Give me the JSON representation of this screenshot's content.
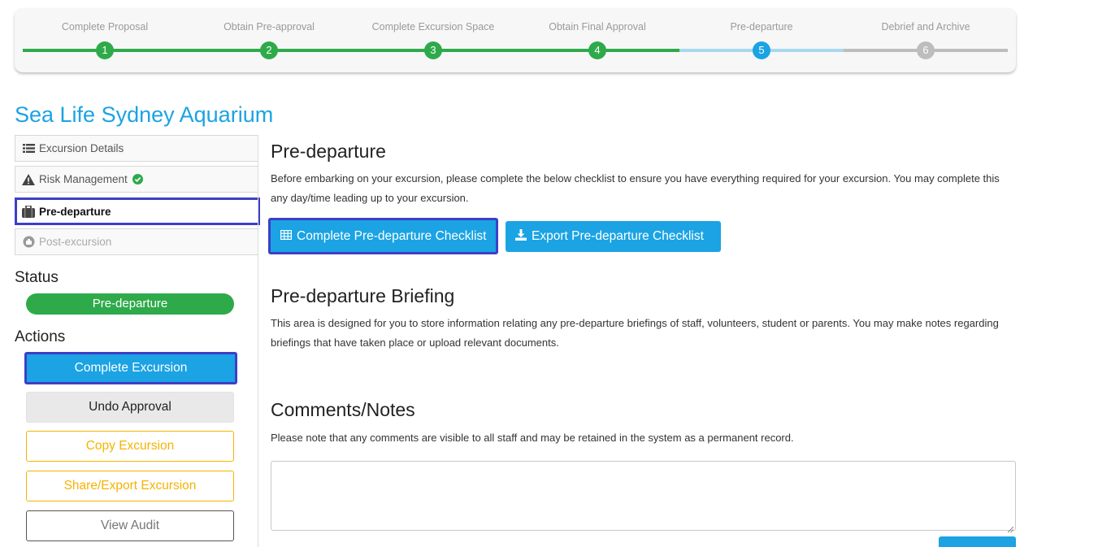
{
  "stepper": {
    "steps": [
      {
        "label": "Complete Proposal",
        "number": "1",
        "state": "done"
      },
      {
        "label": "Obtain Pre-approval",
        "number": "2",
        "state": "done"
      },
      {
        "label": "Complete Excursion Space",
        "number": "3",
        "state": "done"
      },
      {
        "label": "Obtain Final Approval",
        "number": "4",
        "state": "done"
      },
      {
        "label": "Pre-departure",
        "number": "5",
        "state": "current"
      },
      {
        "label": "Debrief and Archive",
        "number": "6",
        "state": "todo"
      }
    ]
  },
  "title": "Sea Life Sydney Aquarium",
  "sidebar": {
    "tabs": [
      {
        "label": "Excursion Details",
        "icon": "list-icon"
      },
      {
        "label": "Risk Management",
        "icon": "warning-icon",
        "badge": "check-circle-icon"
      },
      {
        "label": "Pre-departure",
        "icon": "briefcase-icon"
      },
      {
        "label": "Post-excursion",
        "icon": "post-icon"
      }
    ],
    "status_heading": "Status",
    "status_value": "Pre-departure",
    "actions_heading": "Actions",
    "actions": {
      "complete": "Complete Excursion",
      "undo": "Undo Approval",
      "copy": "Copy Excursion",
      "share": "Share/Export Excursion",
      "audit": "View Audit"
    }
  },
  "main": {
    "predeparture": {
      "heading": "Pre-departure",
      "text": "Before embarking on your excursion, please complete the below checklist to ensure you have everything required for your excursion. You may complete this any day/time leading up to your excursion.",
      "complete_btn": "Complete Pre-departure Checklist",
      "export_btn": "Export Pre-departure Checklist"
    },
    "briefing": {
      "heading": "Pre-departure Briefing",
      "text": "This area is designed for you to store information relating any pre-departure briefings of staff, volunteers, student or parents. You may make notes regarding briefings that have taken place or upload relevant documents."
    },
    "comments": {
      "heading": "Comments/Notes",
      "text": "Please note that any comments are visible to all staff and may be retained in the system as a permanent record."
    }
  },
  "colors": {
    "accent": "#1ba3e4",
    "done": "#2eaa4a",
    "current_line": "#a8d8ee",
    "todo": "#bdbdbd",
    "highlight": "#3d3fc7",
    "warning": "#f5b300"
  }
}
